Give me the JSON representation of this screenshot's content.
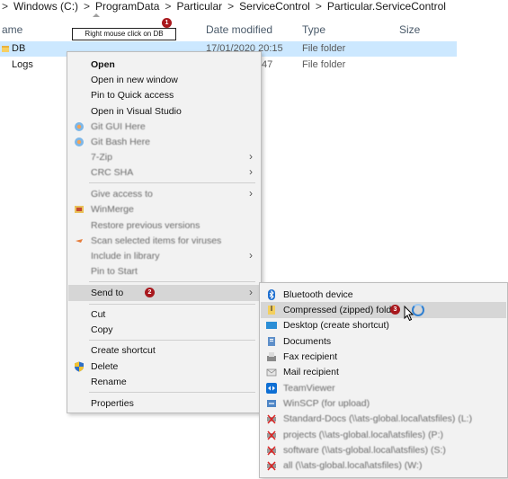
{
  "breadcrumb": {
    "items": [
      "Windows (C:)",
      "ProgramData",
      "Particular",
      "ServiceControl",
      "Particular.ServiceControl"
    ],
    "separator": ">"
  },
  "columns": {
    "name": "ame",
    "date_modified": "Date modified",
    "type": "Type",
    "size": "Size"
  },
  "callouts": {
    "step1_text": "Right mouse click on DB",
    "step1_badge": "1",
    "step2_badge": "2",
    "step3_badge": "3"
  },
  "files": [
    {
      "name": "DB",
      "date": "17/01/2020 20:15",
      "type": "File folder",
      "selected": true
    },
    {
      "name": "Logs",
      "date": ":47",
      "type": "File folder",
      "selected": false
    }
  ],
  "context_menu": {
    "open": "Open",
    "open_new_window": "Open in new window",
    "pin_quick_access": "Pin to Quick access",
    "open_visual_studio": "Open in Visual Studio",
    "git_gui": "Git GUI Here",
    "git_bash": "Git Bash Here",
    "seven_zip": "7-Zip",
    "crc_sha": "CRC SHA",
    "give_access": "Give access to",
    "winmerge": "WinMerge",
    "restore_versions": "Restore previous versions",
    "scan_viruses": "Scan selected items for viruses",
    "include_library": "Include in library",
    "pin_start": "Pin to Start",
    "send_to": "Send to",
    "cut": "Cut",
    "copy": "Copy",
    "create_shortcut": "Create shortcut",
    "delete": "Delete",
    "rename": "Rename",
    "properties": "Properties"
  },
  "send_to_menu": {
    "bluetooth": "Bluetooth device",
    "compressed": "Compressed (zipped) folder",
    "desktop": "Desktop (create shortcut)",
    "documents": "Documents",
    "fax": "Fax recipient",
    "mail": "Mail recipient",
    "teamviewer": "TeamViewer",
    "winscp": "WinSCP (for upload)",
    "standard_docs": "Standard-Docs (\\\\ats-global.local\\atsfiles) (L:)",
    "projects": "projects (\\\\ats-global.local\\atsfiles) (P:)",
    "software": "software (\\\\ats-global.local\\atsfiles) (S:)",
    "all": "all (\\\\ats-global.local\\atsfiles) (W:)"
  },
  "colors": {
    "selection": "#cce8ff",
    "menu_bg": "#f2f2f2",
    "menu_highlight": "#d6d6d6",
    "badge": "#a8181d"
  },
  "icons": {
    "breadcrumb_separator": "chevron-right-icon",
    "folder": "folder-icon",
    "git": "git-icon",
    "submenu": "chevron-right-icon",
    "shield": "uac-shield-icon",
    "bluetooth": "bluetooth-icon",
    "zip": "zip-folder-icon",
    "desktop": "desktop-icon",
    "documents": "documents-icon",
    "fax": "fax-icon",
    "mail": "mail-icon",
    "teamviewer": "teamviewer-icon",
    "network_drive": "network-drive-icon"
  }
}
